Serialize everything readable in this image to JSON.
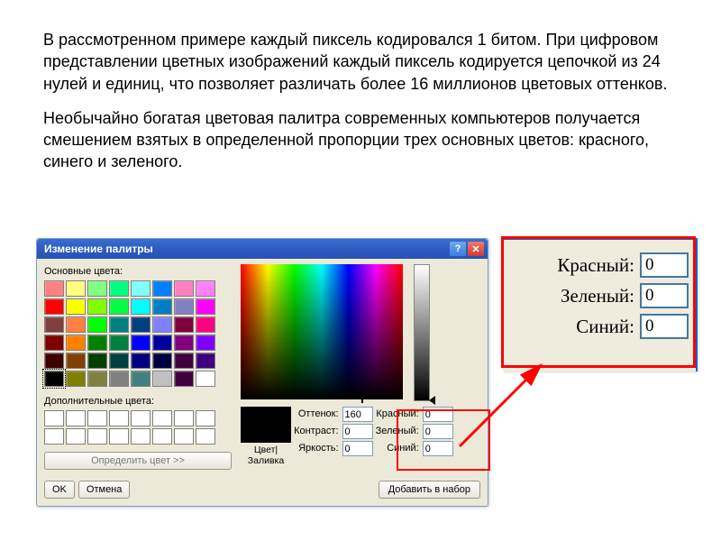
{
  "paragraphs": {
    "p1": "В рассмотренном примере каждый пиксель кодировался 1 битом. При цифровом представлении цветных изображений каждый пиксель кодируется цепочкой из 24 нулей и единиц, что позволяет различать более 16 миллионов цветовых оттенков.",
    "p2": "Необычайно богатая цветовая палитра современных компьютеров получается смешением взятых в определенной пропорции трех основных цветов: красного, синего и зеленого."
  },
  "dialog": {
    "title": "Изменение палитры",
    "basic_label": "Основные цвета:",
    "custom_label": "Дополнительные цвета:",
    "define_btn": "Определить цвет >>",
    "ok": "OK",
    "cancel": "Отмена",
    "solid_label": "Цвет|Заливка",
    "add_btn": "Добавить в набор",
    "hsl": {
      "hue_label": "Оттенок:",
      "hue": "160",
      "sat_label": "Контраст:",
      "sat": "0",
      "lum_label": "Яркость:",
      "lum": "0"
    },
    "rgb": {
      "r_label": "Красный:",
      "r": "0",
      "g_label": "Зеленый:",
      "g": "0",
      "b_label": "Синий:",
      "b": "0"
    },
    "basic_colors": [
      "#ff8080",
      "#ffff80",
      "#80ff80",
      "#00ff80",
      "#80ffff",
      "#0080ff",
      "#ff80c0",
      "#ff80ff",
      "#ff0000",
      "#ffff00",
      "#80ff00",
      "#00ff40",
      "#00ffff",
      "#0080c0",
      "#8080c0",
      "#ff00ff",
      "#804040",
      "#ff8040",
      "#00ff00",
      "#008080",
      "#004080",
      "#8080ff",
      "#800040",
      "#ff0080",
      "#800000",
      "#ff8000",
      "#008000",
      "#008040",
      "#0000ff",
      "#0000a0",
      "#800080",
      "#8000ff",
      "#400000",
      "#804000",
      "#004000",
      "#004040",
      "#000080",
      "#000040",
      "#400040",
      "#400080",
      "#000000",
      "#808000",
      "#808040",
      "#808080",
      "#408080",
      "#c0c0c0",
      "#400040",
      "#ffffff"
    ]
  },
  "zoom": {
    "r_label": "Красный:",
    "r": "0",
    "g_label": "Зеленый:",
    "g": "0",
    "b_label": "Синий:",
    "b": "0"
  }
}
